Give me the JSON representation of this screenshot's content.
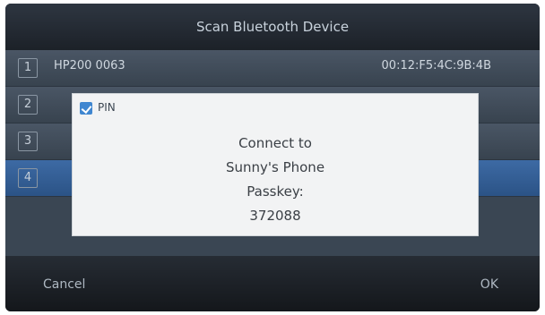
{
  "window": {
    "title": "Scan Bluetooth Device"
  },
  "devices": [
    {
      "index": "1",
      "name": "HP200 0063",
      "address": "00:12:F5:4C:9B:4B"
    },
    {
      "index": "2",
      "name": "",
      "address": ""
    },
    {
      "index": "3",
      "name": "",
      "address": ""
    },
    {
      "index": "4",
      "name": "",
      "address": ""
    }
  ],
  "dialog": {
    "header": "PIN",
    "lines": [
      "Connect to",
      "Sunny's Phone",
      "Passkey:",
      "372088"
    ]
  },
  "softkeys": {
    "left": "Cancel",
    "right": "OK"
  }
}
